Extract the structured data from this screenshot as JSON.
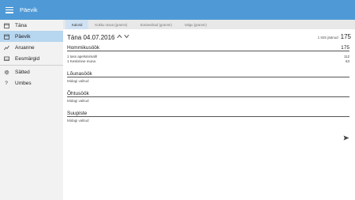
{
  "app": {
    "title": "Päevik"
  },
  "sidebar": {
    "items": [
      {
        "label": "Täna",
        "icon": "calendar-icon"
      },
      {
        "label": "Päevik",
        "icon": "calendar-icon"
      },
      {
        "label": "Aruanne",
        "icon": "chart-icon"
      },
      {
        "label": "Eesmärgid",
        "icon": "flag-icon"
      },
      {
        "label": "Sätted",
        "icon": "gear-icon"
      },
      {
        "label": "Umbes",
        "icon": "question-icon"
      }
    ],
    "active": "Päevik"
  },
  "tabs": [
    {
      "label": "Kalorid"
    },
    {
      "label": "Kokku rasva (gramm)"
    },
    {
      "label": "Süsivesikud (gramm)"
    },
    {
      "label": "Valgu (gramm)"
    }
  ],
  "active_tab": "Kalorid",
  "day": {
    "date_label": "Täna 04.07.2016",
    "remaining_label": "1 825 jäänud",
    "total": "175"
  },
  "meals": [
    {
      "name": "Hommikusöök",
      "kcal": "175",
      "items": [
        {
          "name": "1 tass apelsinimahl",
          "kcal": "112"
        },
        {
          "name": "1 Keskmine muna",
          "kcal": "63"
        }
      ]
    },
    {
      "name": "Lõunasöök",
      "kcal": "",
      "empty": "Midagi valitud"
    },
    {
      "name": "Õhtusöök",
      "kcal": "",
      "empty": "Midagi valitud"
    },
    {
      "name": "Suupiste",
      "kcal": "",
      "empty": "Midagi valitud"
    }
  ]
}
